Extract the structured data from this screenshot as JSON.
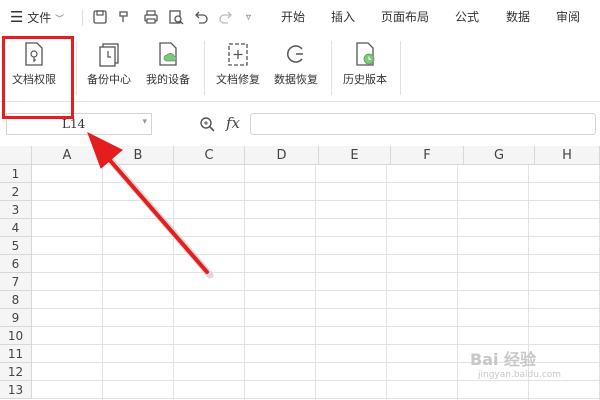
{
  "menubar": {
    "file_label": "文件",
    "tabs": [
      "开始",
      "插入",
      "页面布局",
      "公式",
      "数据",
      "审阅"
    ]
  },
  "toolbar": {
    "buttons": [
      {
        "label": "文档权限",
        "icon": "doc-permission-icon"
      },
      {
        "label": "备份中心",
        "icon": "backup-center-icon"
      },
      {
        "label": "我的设备",
        "icon": "my-device-icon"
      },
      {
        "label": "文档修复",
        "icon": "doc-repair-icon"
      },
      {
        "label": "数据恢复",
        "icon": "data-recovery-icon"
      },
      {
        "label": "历史版本",
        "icon": "history-version-icon"
      }
    ]
  },
  "formula_bar": {
    "name_box_value": "L14",
    "fx_label": "fx",
    "formula_value": ""
  },
  "sheet": {
    "columns": [
      "A",
      "B",
      "C",
      "D",
      "E",
      "F",
      "G",
      "H"
    ],
    "rows": [
      "1",
      "2",
      "3",
      "4",
      "5",
      "6",
      "7",
      "8",
      "9",
      "10",
      "11",
      "12",
      "13"
    ]
  },
  "annotation": {
    "highlight_color": "#e41e1e"
  },
  "watermark": {
    "text": "Bai 经验",
    "subtext": "jingyan.baidu.com"
  }
}
